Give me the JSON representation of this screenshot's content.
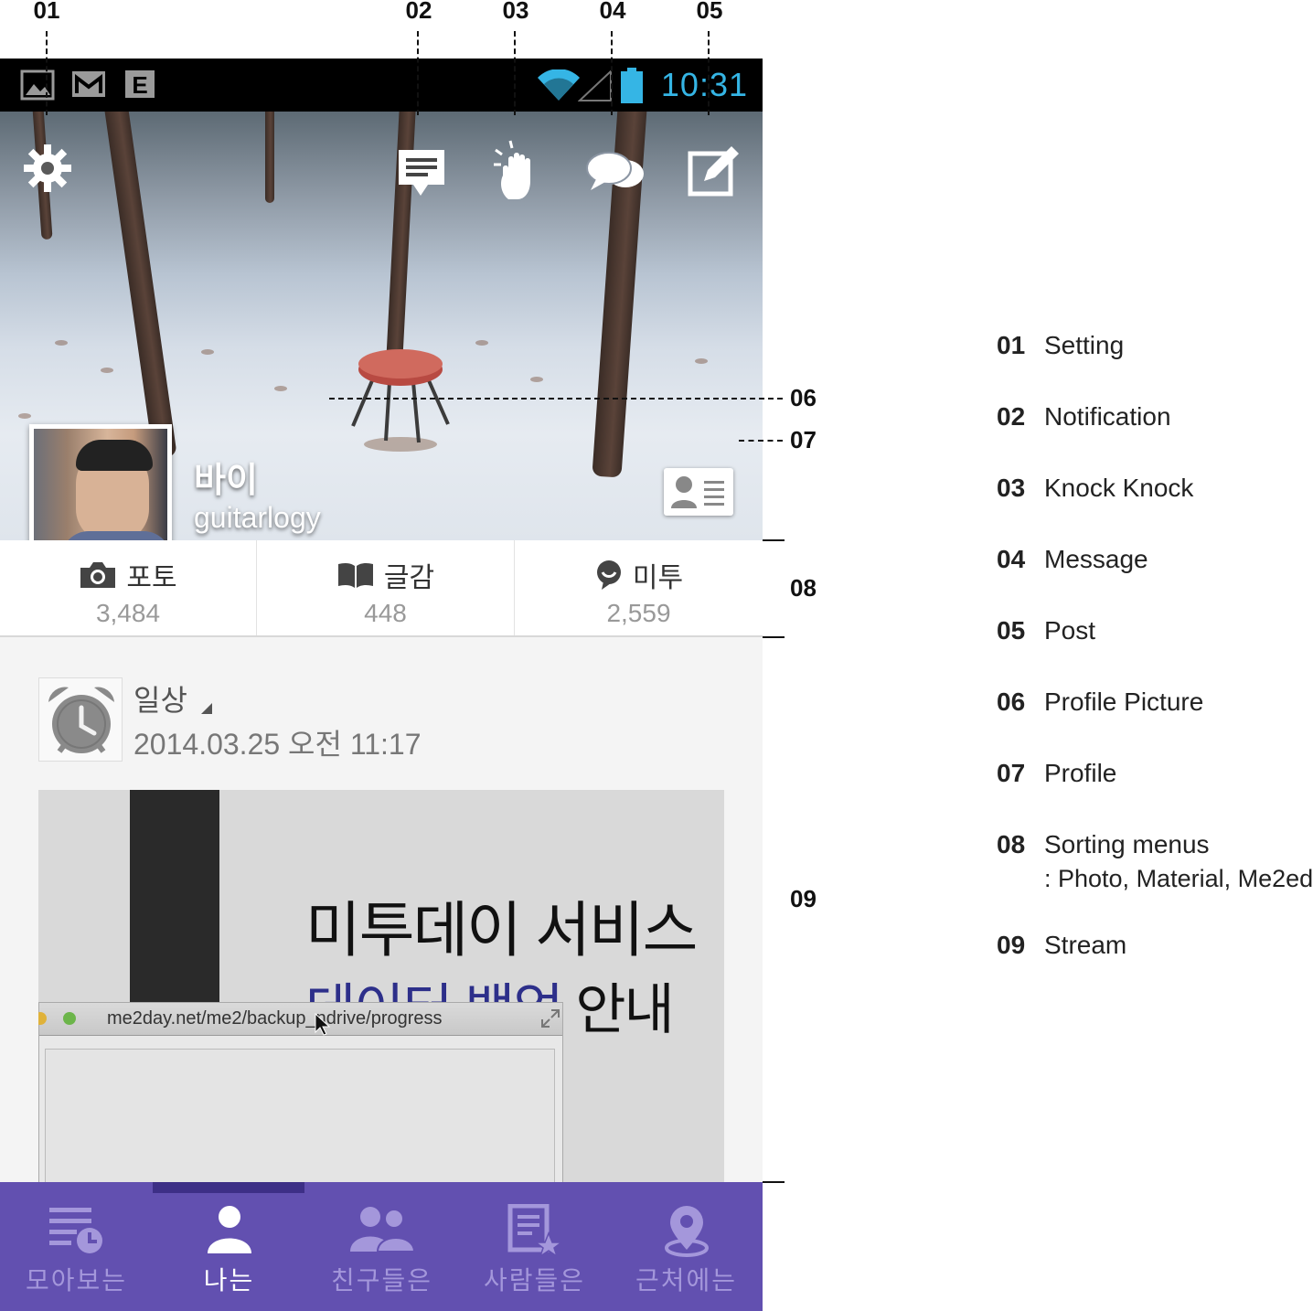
{
  "callouts_top": [
    "01",
    "02",
    "03",
    "04",
    "05"
  ],
  "callouts_side": [
    "06",
    "07",
    "08",
    "09"
  ],
  "status_bar": {
    "time": "10:31",
    "icons": [
      "picture-icon",
      "gmail-icon",
      "edge-network-icon",
      "wifi-icon",
      "signal-icon",
      "battery-icon"
    ],
    "time_color": "#35b5e5"
  },
  "header_icons": [
    "gear-icon",
    "notification-icon",
    "knock-hand-icon",
    "message-bubbles-icon",
    "post-edit-icon"
  ],
  "profile": {
    "display_name": "바이",
    "user_id": "guitarlogy"
  },
  "sort_menu": [
    {
      "label": "포토",
      "count": "3,484",
      "icon": "camera-icon"
    },
    {
      "label": "글감",
      "count": "448",
      "icon": "book-icon"
    },
    {
      "label": "미투",
      "count": "2,559",
      "icon": "speech-bubble-icon"
    }
  ],
  "post": {
    "category": "일상",
    "date": "2014.03.25 오전 11:17",
    "category_icon": "alarm-clock-icon",
    "image_headline": "미투데이 서비스 ",
    "image_sub_blue": "데이터 백업",
    "image_sub": " 안내",
    "image_url": "me2day.net/me2/backup_ndrive/progress"
  },
  "bottom_nav": {
    "items": [
      {
        "label": "모아보는",
        "icon": "list-clock-icon",
        "active": false
      },
      {
        "label": "나는",
        "icon": "person-icon",
        "active": true
      },
      {
        "label": "친구들은",
        "icon": "friends-icon",
        "active": false
      },
      {
        "label": "사람들은",
        "icon": "doc-star-icon",
        "active": false
      },
      {
        "label": "근처에는",
        "icon": "location-pin-icon",
        "active": false
      }
    ],
    "bg_color": "#6250b0",
    "inactive_color": "#a497db"
  },
  "legend": [
    {
      "num": "01",
      "text": "Setting"
    },
    {
      "num": "02",
      "text": "Notification"
    },
    {
      "num": "03",
      "text": "Knock Knock"
    },
    {
      "num": "04",
      "text": "Message"
    },
    {
      "num": "05",
      "text": "Post"
    },
    {
      "num": "06",
      "text": "Profile Picture"
    },
    {
      "num": "07",
      "text": "Profile"
    },
    {
      "num": "08",
      "text": "Sorting menus",
      "sub": ": Photo, Material, Me2ed"
    },
    {
      "num": "09",
      "text": "Stream"
    }
  ]
}
